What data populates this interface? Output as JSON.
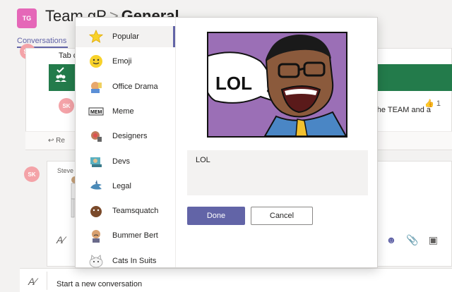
{
  "header": {
    "avatar_initials": "TG",
    "team_name": "Team gP",
    "separator": ">",
    "channel_name": "General ..."
  },
  "tabs": {
    "conversations": "Conversations"
  },
  "feed": {
    "tab_text": "Tab c",
    "reply_label": "Re",
    "like_count": "1",
    "message_snippet": "he TEAM and a",
    "author_initials": "SK",
    "author_name": "Steve I"
  },
  "compose": {
    "new_conversation": "Start a new conversation"
  },
  "popup": {
    "categories": [
      {
        "label": "Popular",
        "icon": "star-icon",
        "selected": true
      },
      {
        "label": "Emoji",
        "icon": "emoji-face-icon",
        "selected": false
      },
      {
        "label": "Office Drama",
        "icon": "office-drama-icon",
        "selected": false
      },
      {
        "label": "Meme",
        "icon": "meme-icon",
        "selected": false
      },
      {
        "label": "Designers",
        "icon": "designers-icon",
        "selected": false
      },
      {
        "label": "Devs",
        "icon": "devs-icon",
        "selected": false
      },
      {
        "label": "Legal",
        "icon": "legal-shark-icon",
        "selected": false
      },
      {
        "label": "Teamsquatch",
        "icon": "teamsquatch-icon",
        "selected": false
      },
      {
        "label": "Bummer Bert",
        "icon": "bummer-bert-icon",
        "selected": false
      },
      {
        "label": "Cats In Suits",
        "icon": "cat-icon",
        "selected": false
      }
    ],
    "sticker_text": "LOL",
    "caption_value": "LOL",
    "done_label": "Done",
    "cancel_label": "Cancel"
  },
  "colors": {
    "accent": "#6264a7",
    "banner_green": "#237b4b",
    "team_avatar": "#e567b8",
    "sticker_background": "#9b6fb6"
  }
}
